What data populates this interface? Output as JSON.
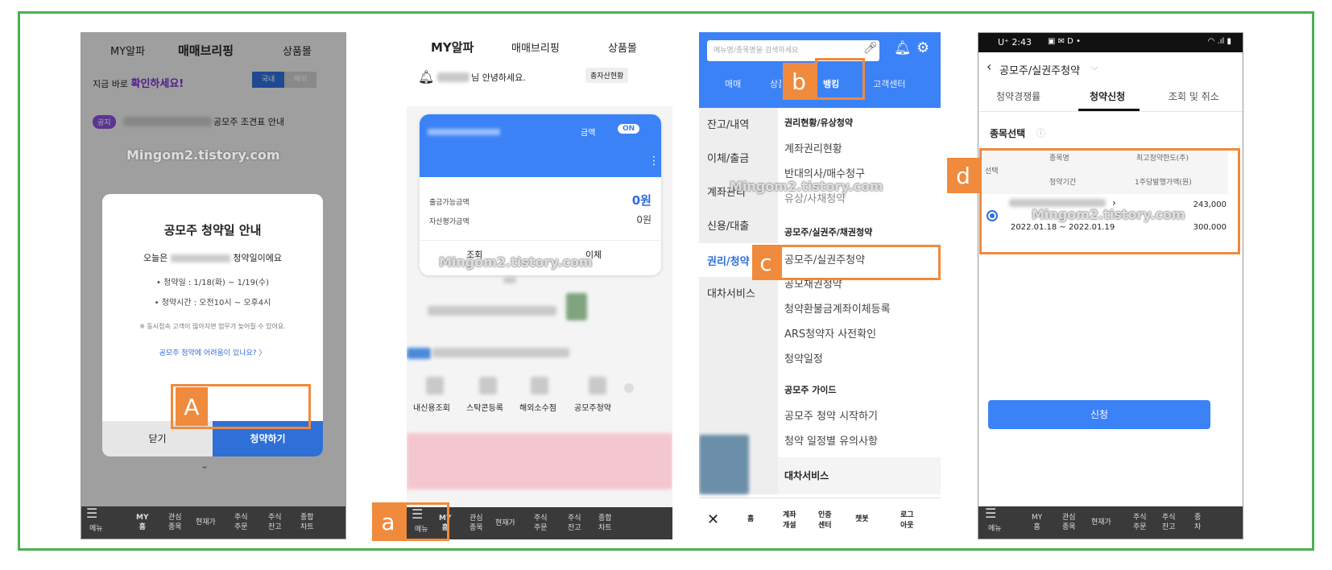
{
  "watermark": "Mingom2.tistory.com",
  "colors": {
    "border": "#4caf50",
    "highlight": "#f08a3c",
    "accent": "#3b82f6"
  },
  "labels": {
    "A": "A",
    "a": "a",
    "b": "b",
    "c": "c",
    "d": "d"
  },
  "p1": {
    "tabs": [
      "MY알파",
      "매매브리핑",
      "상품몰"
    ],
    "promo_prefix": "지금 바로",
    "promo_em": "확인하세요!",
    "toggle": [
      "국내",
      "해외"
    ],
    "notice_badge": "공지",
    "notice_text": "공모주 조견표 안내",
    "modal": {
      "title": "공모주 청약일 안내",
      "today_prefix": "오늘은",
      "today_suffix": "청약일이에요",
      "date": "• 청약일 : 1/18(화) ~ 1/19(수)",
      "time": "• 청약시간 : 오전10시 ~ 오후4시",
      "warn": "※ 동시접속 고객이 많아지면 업무가 늦어질 수 있어요.",
      "link": "공모주 청약에 어려움이 있나요? 〉",
      "close": "닫기",
      "apply": "청약하기"
    },
    "nav": [
      {
        "line1": "",
        "line2": "메뉴"
      },
      {
        "line1": "MY",
        "line2": "홈"
      },
      {
        "line1": "관심",
        "line2": "종목"
      },
      {
        "line1": "현재가",
        "line2": ""
      },
      {
        "line1": "주식",
        "line2": "주문"
      },
      {
        "line1": "주식",
        "line2": "잔고"
      },
      {
        "line1": "종합",
        "line2": "차트"
      }
    ]
  },
  "p2": {
    "tabs": [
      "MY알파",
      "매매브리핑",
      "상품몰"
    ],
    "greeting": "님 안녕하세요.",
    "total_btn": "총자산현황",
    "card": {
      "toggle_label": "금액",
      "toggle_state": "ON",
      "withdraw_label": "출금가능금액",
      "withdraw_value": "0원",
      "asset_label": "자산평가금액",
      "asset_value": "0원",
      "btn1": "조회",
      "btn2": "이체"
    },
    "shortcuts": [
      "내신용조회",
      "스탁콘등록",
      "해외소수점",
      "공모주청약"
    ],
    "nav": [
      {
        "line1": "",
        "line2": "메뉴"
      },
      {
        "line1": "MY",
        "line2": "홈"
      },
      {
        "line1": "관심",
        "line2": "종목"
      },
      {
        "line1": "현재가",
        "line2": ""
      },
      {
        "line1": "주식",
        "line2": "주문"
      },
      {
        "line1": "주식",
        "line2": "잔고"
      },
      {
        "line1": "종합",
        "line2": "차트"
      }
    ]
  },
  "p3": {
    "search_placeholder": "메뉴명/종목명을 검색하세요",
    "tabs": [
      "매매",
      "상품",
      "뱅킹",
      "고객센터"
    ],
    "left_menu": [
      "잔고/내역",
      "이체/출금",
      "계좌관리",
      "신용/대출",
      "권리/청약",
      "대차서비스"
    ],
    "sec1": "권리현황/유상청약",
    "items1": [
      "계좌권리현황",
      "반대의사/매수청구",
      "유상/사채청약"
    ],
    "sec2": "공모주/실권주/채권청약",
    "items2": [
      "공모주/실권주청약",
      "공모채권청약",
      "청약환불금계좌이체등록",
      "ARS청약자 사전확인",
      "청약일정"
    ],
    "sec3": "공모주 가이드",
    "items3": [
      "공모주 청약 시작하기",
      "청약 일정별 유의사항"
    ],
    "sec4": "대차서비스",
    "bottom": [
      {
        "line1": "홈",
        "line2": ""
      },
      {
        "line1": "계좌",
        "line2": "개설"
      },
      {
        "line1": "인증",
        "line2": "센터"
      },
      {
        "line1": "챗봇",
        "line2": ""
      },
      {
        "line1": "로그",
        "line2": "아웃"
      }
    ]
  },
  "p4": {
    "status": {
      "time": "U⁺ 2:43",
      "icons": "▣ ✉ D •",
      "right": "◠ .ıl ▮"
    },
    "title": "공모주/실권주청약",
    "tabs": [
      "청약경쟁률",
      "청약신청",
      "조회 및 취소"
    ],
    "section": "종목선택",
    "table": {
      "h_select": "선택",
      "h_name": "종목명",
      "h_limit": "최고청약한도(주)",
      "h_period": "청약기간",
      "h_price": "1주당발행가액(원)",
      "row_limit": "243,000",
      "row_period": "2022.01.18 ~ 2022.01.19",
      "row_price": "300,000"
    },
    "apply": "신청",
    "nav": [
      {
        "line1": "",
        "line2": "메뉴"
      },
      {
        "line1": "MY",
        "line2": "홈"
      },
      {
        "line1": "관심",
        "line2": "종목"
      },
      {
        "line1": "현재가",
        "line2": ""
      },
      {
        "line1": "주식",
        "line2": "주문"
      },
      {
        "line1": "주식",
        "line2": "잔고"
      },
      {
        "line1": "종",
        "line2": "차"
      }
    ]
  }
}
